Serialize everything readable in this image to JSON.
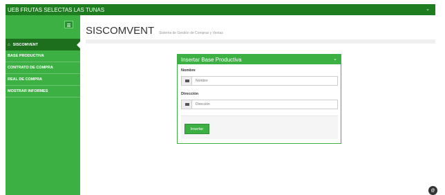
{
  "topbar": {
    "title": "UEB FRUTAS SELECTAS LAS TUNAS",
    "caret": "⌄"
  },
  "sidebar": {
    "items": [
      {
        "label": "SISCOMVENT",
        "active": true
      },
      {
        "label": "BASE PRODUCTIVA"
      },
      {
        "label": "CONTRATO DE COMPRA"
      },
      {
        "label": "REAL DE COMPRA"
      },
      {
        "label": "MOSTRAR INFORMES"
      }
    ]
  },
  "header": {
    "title": "SISCOMVENT",
    "subtitle": "Sistema de Gestión de Compras y Ventas"
  },
  "form": {
    "panel_title": "Insertar Base Productiva",
    "caret": "⌄",
    "fields": [
      {
        "label": "Nombre",
        "placeholder": "Nombre",
        "value": ""
      },
      {
        "label": "Dirección",
        "placeholder": "Dirección",
        "value": ""
      }
    ],
    "submit_label": "Insertar"
  },
  "badge": {
    "label": "@"
  },
  "colors": {
    "primary": "#3cb043",
    "dark": "#1e7d1e",
    "active": "#1d6e1d"
  }
}
